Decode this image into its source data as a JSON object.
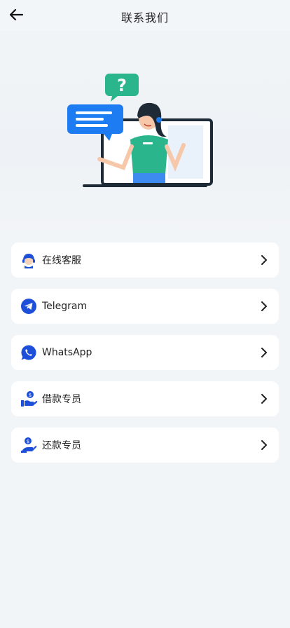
{
  "header": {
    "title": "联系我们",
    "back_icon": "arrow-left-icon"
  },
  "hero": {
    "illustration": "customer-support-agent-illustration",
    "question_mark": "?"
  },
  "contacts": [
    {
      "label": "在线客服",
      "icon": "headset-agent-icon"
    },
    {
      "label": "Telegram",
      "icon": "telegram-icon"
    },
    {
      "label": "WhatsApp",
      "icon": "whatsapp-icon"
    },
    {
      "label": "借款专员",
      "icon": "loan-hand-coin-icon"
    },
    {
      "label": "还款专员",
      "icon": "repay-hand-coin-icon"
    }
  ],
  "colors": {
    "accent_blue": "#1d4fd8",
    "illustration_green": "#2bb58d",
    "bubble_blue": "#1e7cf2",
    "background": "#f2f5f7"
  }
}
